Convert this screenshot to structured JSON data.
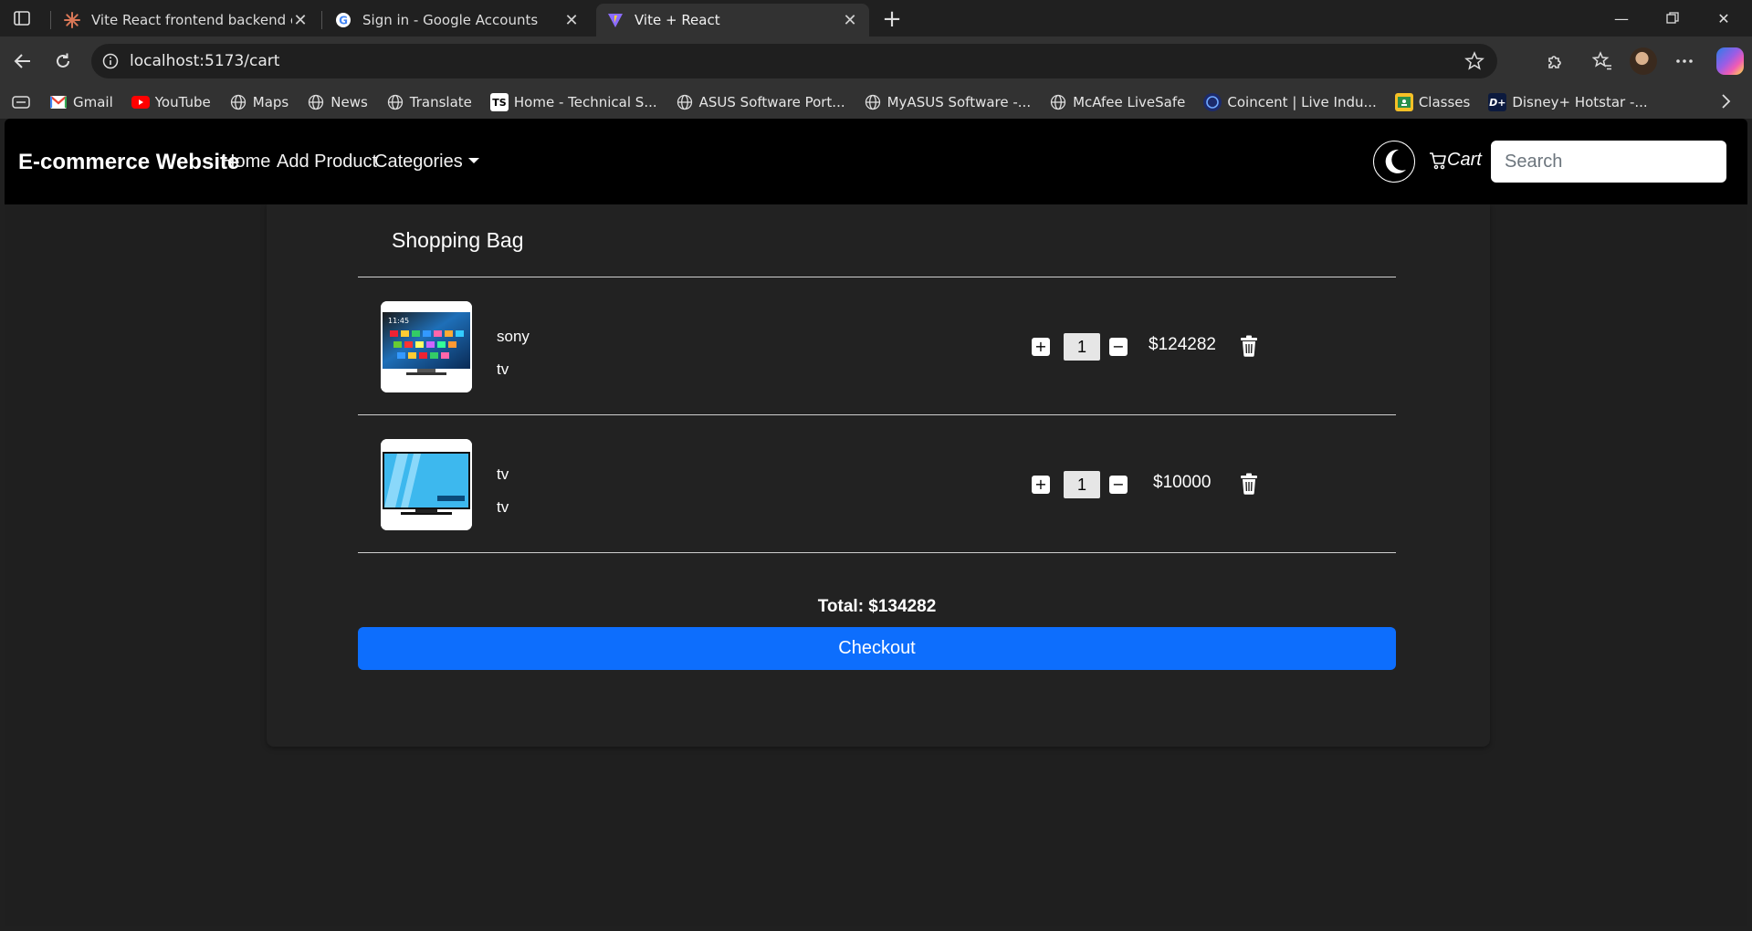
{
  "browser": {
    "tabs": [
      {
        "title": "Vite React frontend backend conn",
        "favicon": "claude-icon",
        "active": false
      },
      {
        "title": "Sign in - Google Accounts",
        "favicon": "google-icon",
        "active": false
      },
      {
        "title": "Vite + React",
        "favicon": "vite-icon",
        "active": true
      }
    ],
    "url": "localhost:5173/cart",
    "bookmarks": [
      {
        "label": "Gmail",
        "icon": "gmail-icon"
      },
      {
        "label": "YouTube",
        "icon": "youtube-icon"
      },
      {
        "label": "Maps",
        "icon": "globe-icon"
      },
      {
        "label": "News",
        "icon": "globe-icon"
      },
      {
        "label": "Translate",
        "icon": "globe-icon"
      },
      {
        "label": "Home - Technical S...",
        "icon": "ts-icon"
      },
      {
        "label": "ASUS Software Port...",
        "icon": "globe-icon"
      },
      {
        "label": "MyASUS Software -...",
        "icon": "globe-icon"
      },
      {
        "label": "McAfee LiveSafe",
        "icon": "globe-icon"
      },
      {
        "label": "Coincent | Live Indu...",
        "icon": "coincent-icon"
      },
      {
        "label": "Classes",
        "icon": "classroom-icon"
      },
      {
        "label": "Disney+ Hotstar -...",
        "icon": "hotstar-icon"
      }
    ]
  },
  "navbar": {
    "brand": "E-commerce Website",
    "links": [
      "Home",
      "Add Product",
      "Categories"
    ],
    "cart_label": "Cart",
    "search_placeholder": "Search"
  },
  "cart": {
    "title": "Shopping Bag",
    "items": [
      {
        "name": "sony",
        "category": "tv",
        "quantity": "1",
        "price": "$124282"
      },
      {
        "name": "tv",
        "category": "tv",
        "quantity": "1",
        "price": "$10000"
      }
    ],
    "total_label": "Total: $134282",
    "checkout_label": "Checkout"
  },
  "colors": {
    "accent": "#0d6efd",
    "navbar_bg": "#000000",
    "page_bg": "#1f1f1f",
    "card_bg": "#222222"
  }
}
